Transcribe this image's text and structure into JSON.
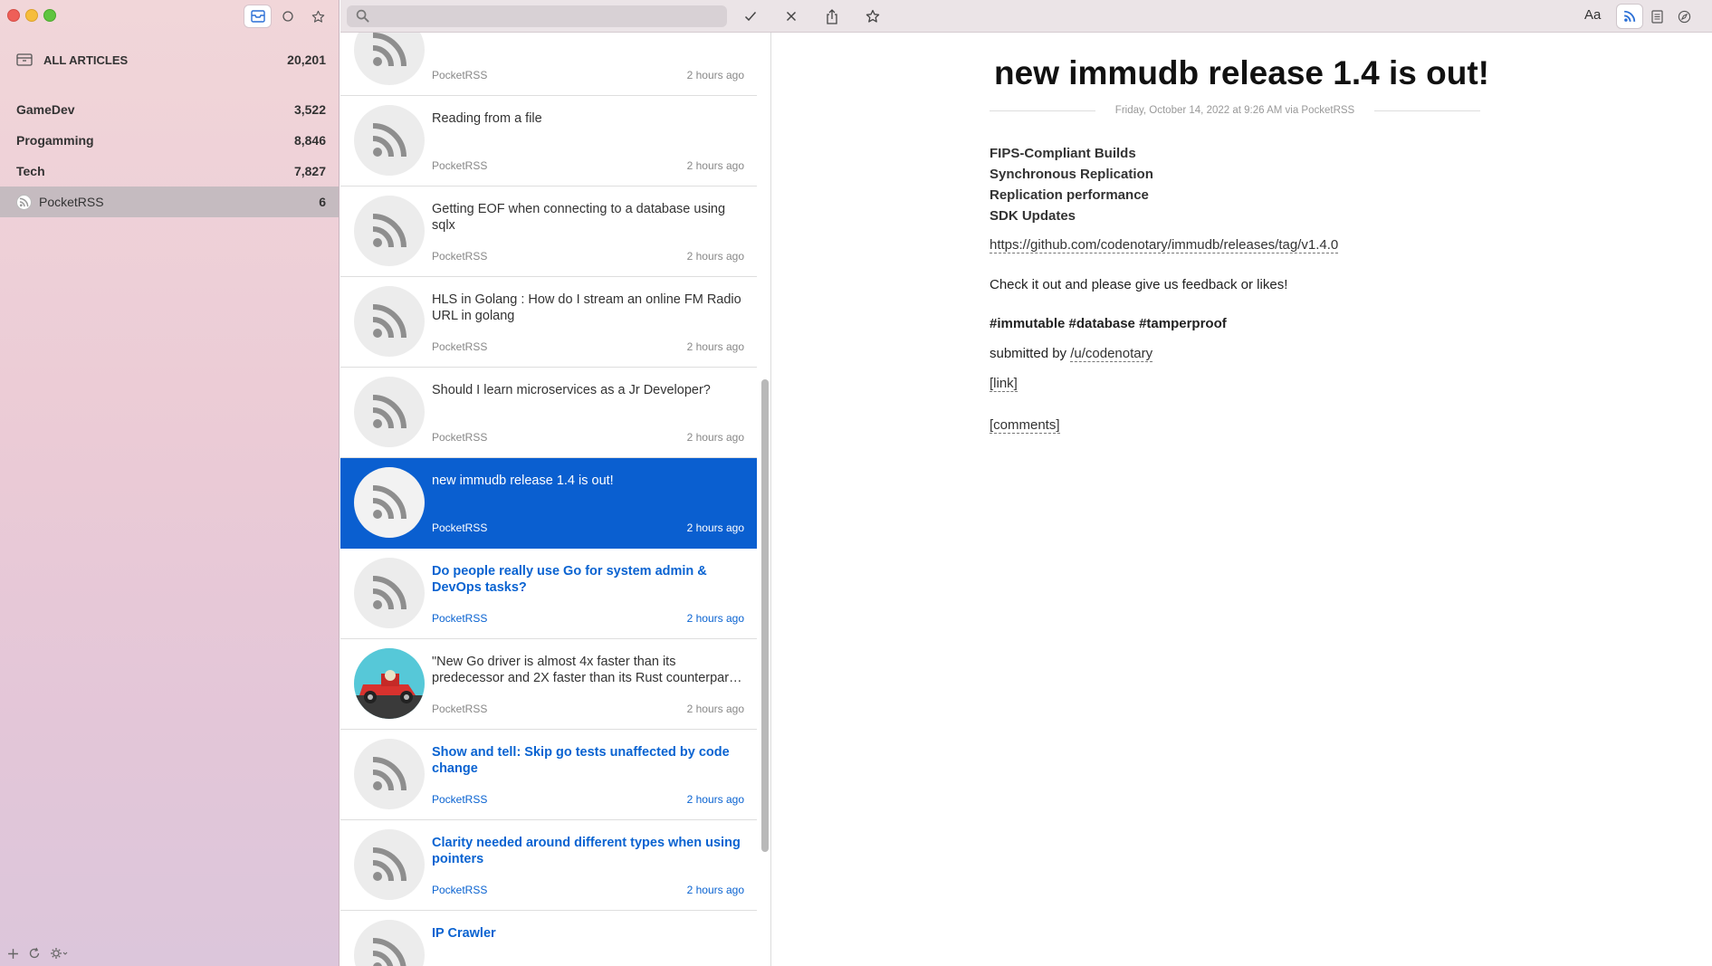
{
  "sidebar": {
    "all_articles": {
      "label": "ALL ARTICLES",
      "count": "20,201"
    },
    "folders": [
      {
        "label": "GameDev",
        "count": "3,522"
      },
      {
        "label": "Progamming",
        "count": "8,846"
      },
      {
        "label": "Tech",
        "count": "7,827"
      },
      {
        "label": "PocketRSS",
        "count": "6"
      }
    ]
  },
  "toolbar": {
    "search_placeholder": "",
    "font_button": "Aa"
  },
  "articles": [
    {
      "title": "",
      "source": "PocketRSS",
      "time": "2 hours ago",
      "state": "read"
    },
    {
      "title": "Reading from a file",
      "source": "PocketRSS",
      "time": "2 hours ago",
      "state": "read"
    },
    {
      "title": "Getting EOF when connecting to a database using sqlx",
      "source": "PocketRSS",
      "time": "2 hours ago",
      "state": "read"
    },
    {
      "title": "HLS in Golang : How do I stream an online FM Radio URL in golang",
      "source": "PocketRSS",
      "time": "2 hours ago",
      "state": "read"
    },
    {
      "title": "Should I learn microservices as a Jr Developer?",
      "source": "PocketRSS",
      "time": "2 hours ago",
      "state": "read"
    },
    {
      "title": "new immudb release 1.4 is out!",
      "source": "PocketRSS",
      "time": "2 hours ago",
      "state": "selected"
    },
    {
      "title": "Do people really use Go for system admin & DevOps tasks?",
      "source": "PocketRSS",
      "time": "2 hours ago",
      "state": "unread"
    },
    {
      "title": "\"New Go driver is almost 4x faster than its predecessor and 2X faster than its Rust counterpar…",
      "source": "PocketRSS",
      "time": "2 hours ago",
      "state": "read",
      "thumb": "image"
    },
    {
      "title": "Show and tell: Skip go tests unaffected by code change",
      "source": "PocketRSS",
      "time": "2 hours ago",
      "state": "unread"
    },
    {
      "title": "Clarity needed around different types when using pointers",
      "source": "PocketRSS",
      "time": "2 hours ago",
      "state": "unread"
    },
    {
      "title": "IP Crawler",
      "source": "PocketRSS",
      "time": "2 hours ago",
      "state": "unread"
    }
  ],
  "reader": {
    "title": "new immudb release 1.4 is out!",
    "meta": "Friday, October 14, 2022 at 9:26 AM via PocketRSS",
    "features": [
      "FIPS-Compliant Builds",
      "Synchronous Replication",
      "Replication performance",
      "SDK Updates"
    ],
    "release_link": "https://github.com/codenotary/immudb/releases/tag/v1.4.0",
    "check_out": "Check it out and please give us feedback or likes!",
    "tags": "#immutable #database #tamperproof",
    "submitted_prefix": "submitted by ",
    "submitted_user": "/u/codenotary",
    "link_label": "[link]",
    "comments_label": "[comments]"
  }
}
